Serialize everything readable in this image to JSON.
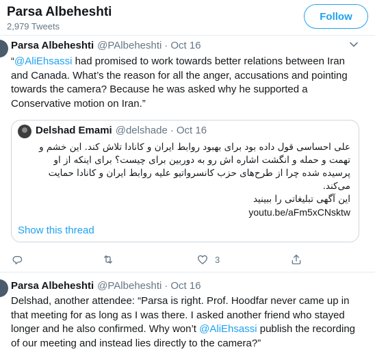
{
  "header": {
    "name": "Parsa Albeheshti",
    "tweet_count": "2,979 Tweets",
    "follow_label": "Follow"
  },
  "tweets": [
    {
      "author": "Parsa Albeheshti",
      "handle": "@PAlbeheshti",
      "dot": "·",
      "date": "Oct 16",
      "mention": "@AliEhsassi",
      "text_open": "“",
      "text_rest": " had promised to work towards better relations between Iran and Canada. What’s the reason for all the anger, accusations and pointing towards the camera? Because he was asked why he supported a Conservative motion on Iran.”",
      "quote": {
        "author": "Delshad Emami",
        "handle": "@delshade",
        "dot": "·",
        "date": "Oct 16",
        "lines": [
          "علی احساسی قول داده  بود برای بهبود روابط ایران و کانادا تلاش کند. این خشم و",
          "تهمت و حمله و انگشت اشاره اش رو به دوربین برای چیست؟ برای اینکه از او",
          "پرسیده شده چرا از طرح‌های حزب کانسرواتیو علیه روابط ایران و کانادا حمایت",
          "می‌کند.",
          "این آگهی تبلیغاتی را ببینید"
        ],
        "link": "youtu.be/aFm5xCNsktw"
      },
      "show_thread": "Show this thread",
      "like_count": "3"
    },
    {
      "author": "Parsa Albeheshti",
      "handle": "@PAlbeheshti",
      "dot": "·",
      "date": "Oct 16",
      "text_before": "Delshad, another attendee: “Parsa is right. Prof. Hoodfar never came up in that meeting for as long as I was there. I asked another friend who stayed longer and he also confirmed. Why won’t ",
      "mention": "@AliEhsassi",
      "text_after": " publish the recording of our meeting and instead lies directly to the camera?”"
    }
  ],
  "icons": {
    "reply": "reply-icon",
    "retweet": "retweet-icon",
    "like": "heart-icon",
    "share": "share-icon",
    "caret": "chevron-down-icon"
  },
  "colors": {
    "accent": "#1da1f2",
    "text": "#14171a",
    "muted": "#657786",
    "border": "#e6ecf0"
  }
}
